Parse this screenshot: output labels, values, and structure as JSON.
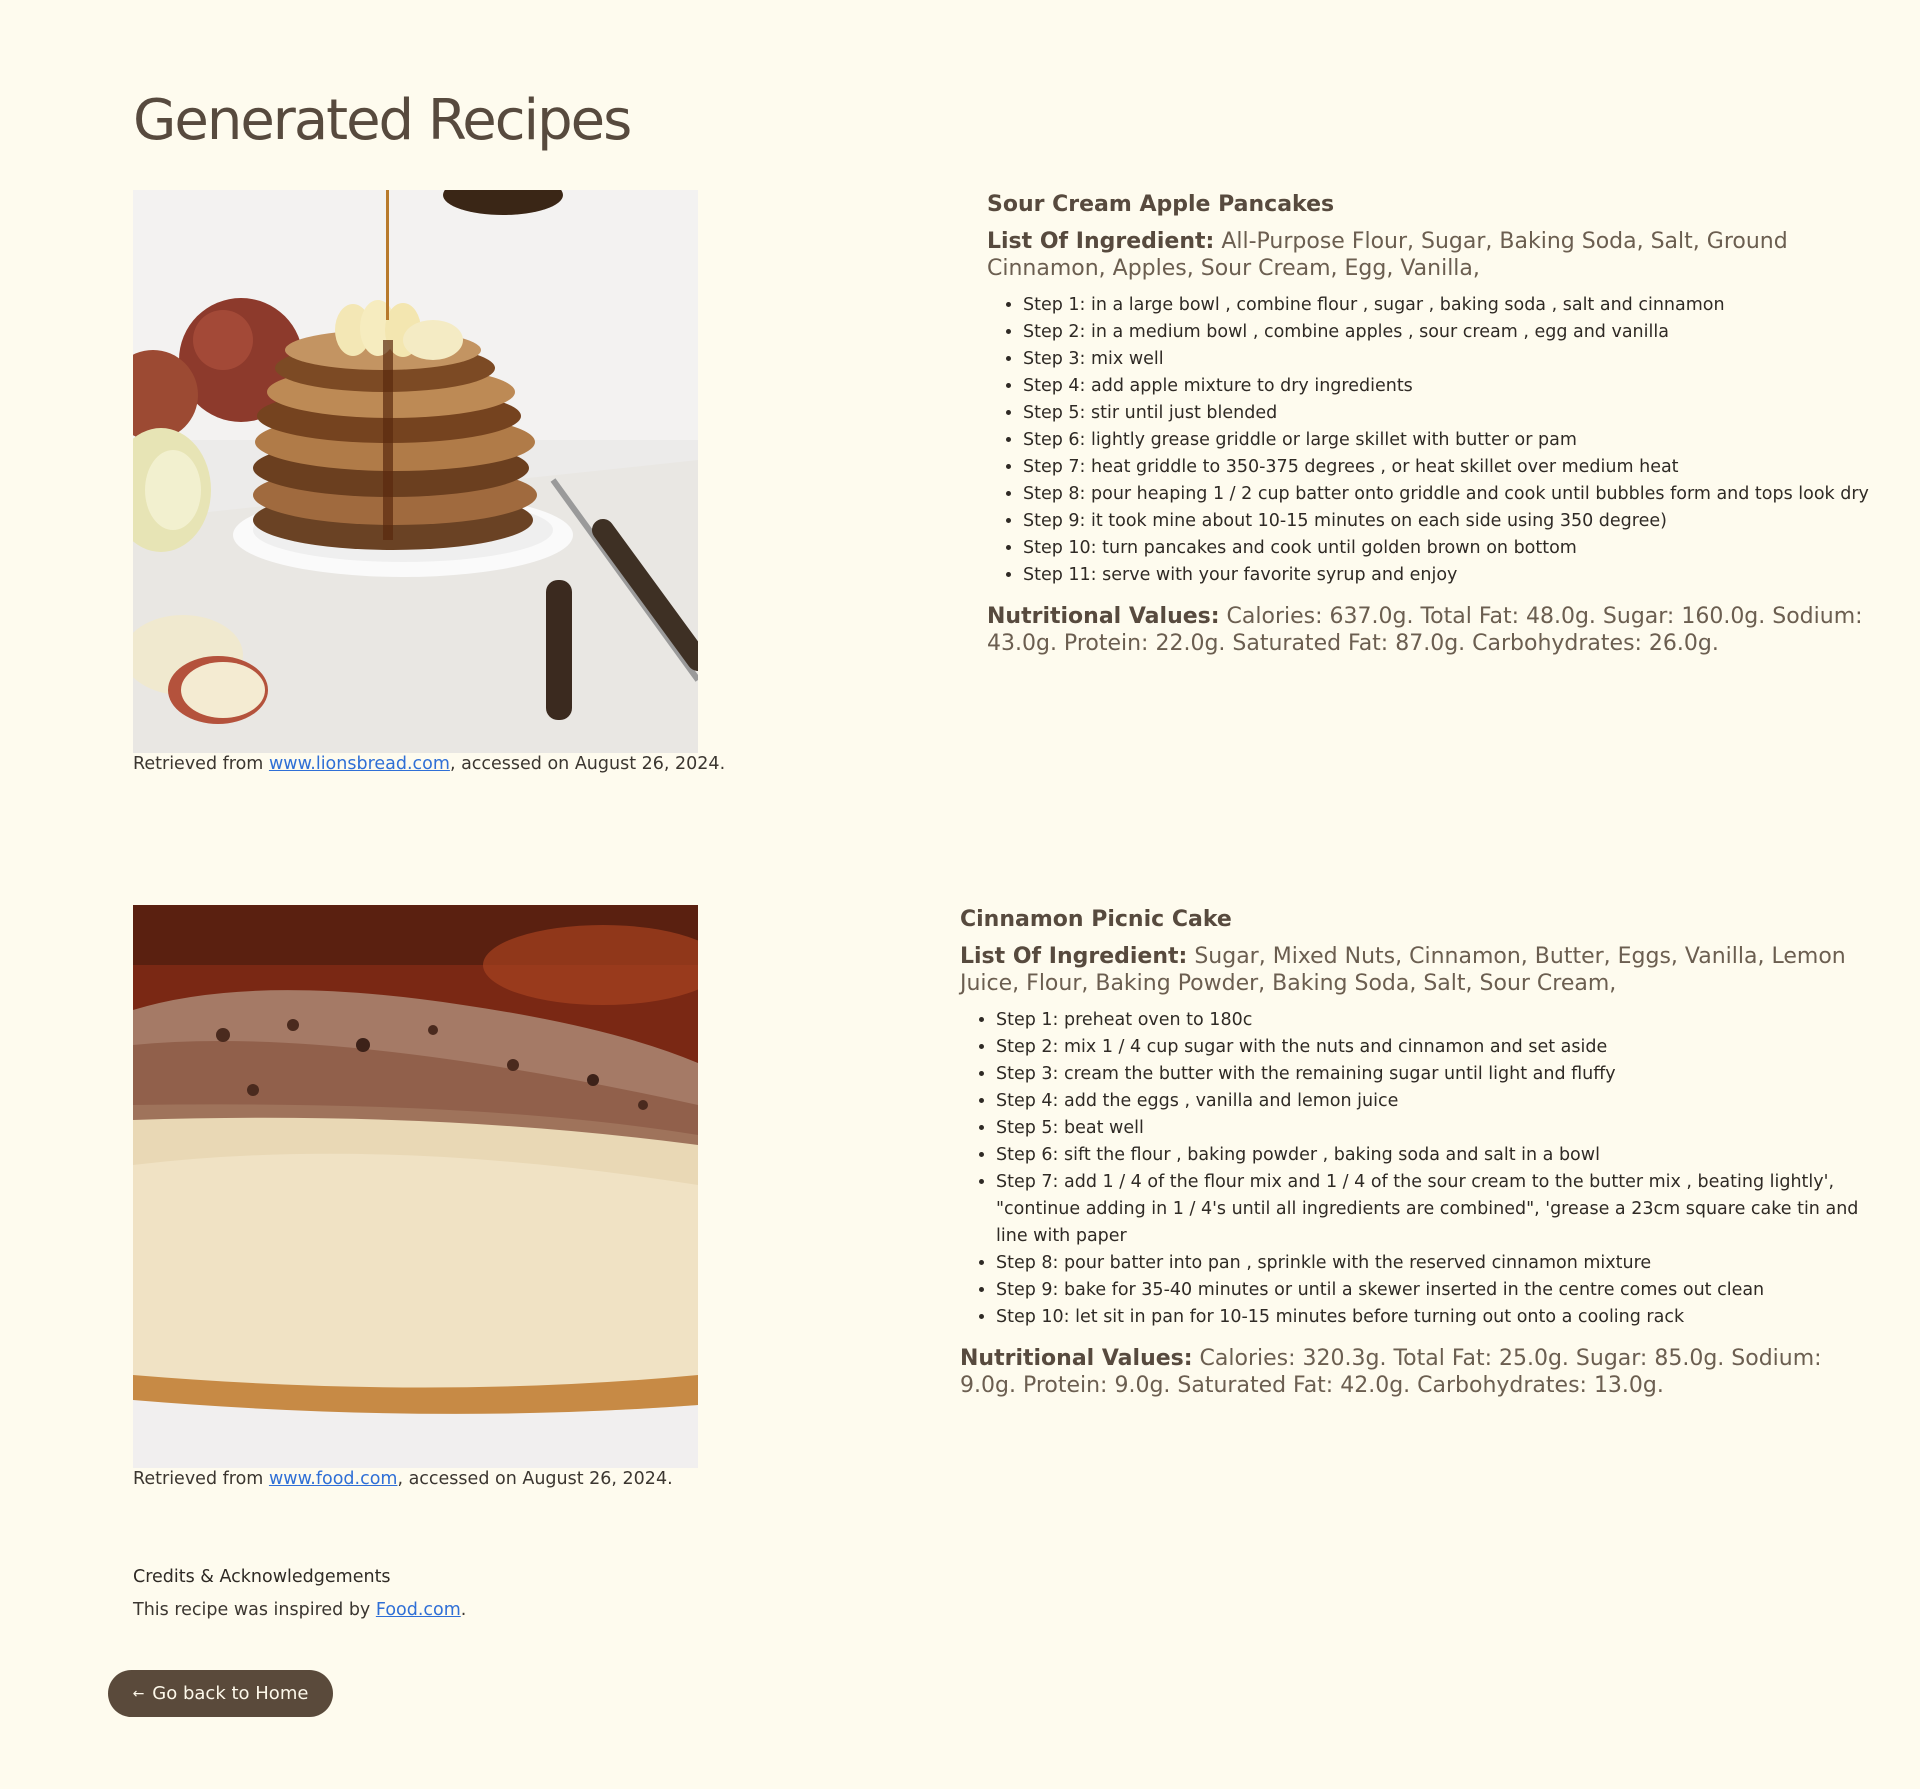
{
  "page": {
    "title": "Generated Recipes"
  },
  "recipes": [
    {
      "name": "Sour Cream Apple Pancakes",
      "ingredients_label": "List Of Ingredient:",
      "ingredients": "All-Purpose Flour, Sugar, Baking Soda, Salt, Ground Cinnamon, Apples, Sour Cream, Egg, Vanilla,",
      "steps": [
        "Step 1: in a large bowl , combine flour , sugar , baking soda , salt and cinnamon",
        "Step 2: in a medium bowl , combine apples , sour cream , egg and vanilla",
        "Step 3: mix well",
        "Step 4: add apple mixture to dry ingredients",
        "Step 5: stir until just blended",
        "Step 6: lightly grease griddle or large skillet with butter or pam",
        "Step 7: heat griddle to 350-375 degrees , or heat skillet over medium heat",
        "Step 8: pour heaping 1 / 2 cup batter onto griddle and cook until bubbles form and tops look dry",
        "Step 9: it took mine about 10-15 minutes on each side using 350 degree)",
        "Step 10: turn pancakes and cook until golden brown on bottom",
        "Step 11: serve with your favorite syrup and enjoy"
      ],
      "nutrition_label": "Nutritional Values:",
      "nutrition": "Calories: 637.0g. Total Fat: 48.0g. Sugar: 160.0g. Sodium: 43.0g. Protein: 22.0g. Saturated Fat: 87.0g. Carbohydrates: 26.0g.",
      "caption_prefix": "Retrieved from",
      "source_link": "www.lionsbread.com",
      "caption_suffix": ", accessed on August 26, 2024."
    },
    {
      "name": "Cinnamon Picnic Cake",
      "ingredients_label": "List Of Ingredient:",
      "ingredients": "Sugar, Mixed Nuts, Cinnamon, Butter, Eggs, Vanilla, Lemon Juice, Flour, Baking Powder, Baking Soda, Salt, Sour Cream,",
      "steps": [
        "Step 1: preheat oven to 180c",
        "Step 2: mix 1 / 4 cup sugar with the nuts and cinnamon and set aside",
        "Step 3: cream the butter with the remaining sugar until light and fluffy",
        "Step 4: add the eggs , vanilla and lemon juice",
        "Step 5: beat well",
        "Step 6: sift the flour , baking powder , baking soda and salt in a bowl",
        "Step 7: add 1 / 4 of the flour mix and 1 / 4 of the sour cream to the butter mix , beating lightly', \"continue adding in 1 / 4's until all ingredients are combined\", 'grease a 23cm square cake tin and line with paper",
        "Step 8: pour batter into pan , sprinkle with the reserved cinnamon mixture",
        "Step 9: bake for 35-40 minutes or until a skewer inserted in the centre comes out clean",
        "Step 10: let sit in pan for 10-15 minutes before turning out onto a cooling rack"
      ],
      "nutrition_label": "Nutritional Values:",
      "nutrition": "Calories: 320.3g. Total Fat: 25.0g. Sugar: 85.0g. Sodium: 9.0g. Protein: 9.0g. Saturated Fat: 42.0g. Carbohydrates: 13.0g.",
      "caption_prefix": "Retrieved from",
      "source_link": "www.food.com",
      "caption_suffix": ", accessed on August 26, 2024."
    }
  ],
  "credits": {
    "heading": "Credits & Acknowledgements",
    "text_prefix": "This recipe was inspired by",
    "link": "Food.com",
    "text_suffix": "."
  },
  "home_button": {
    "arrow": "←",
    "label": "Go back to Home"
  },
  "colors": {
    "background": "#fefbee",
    "heading": "#574a3e",
    "link": "#2f6fd6",
    "button_bg": "#5a4a3b"
  }
}
